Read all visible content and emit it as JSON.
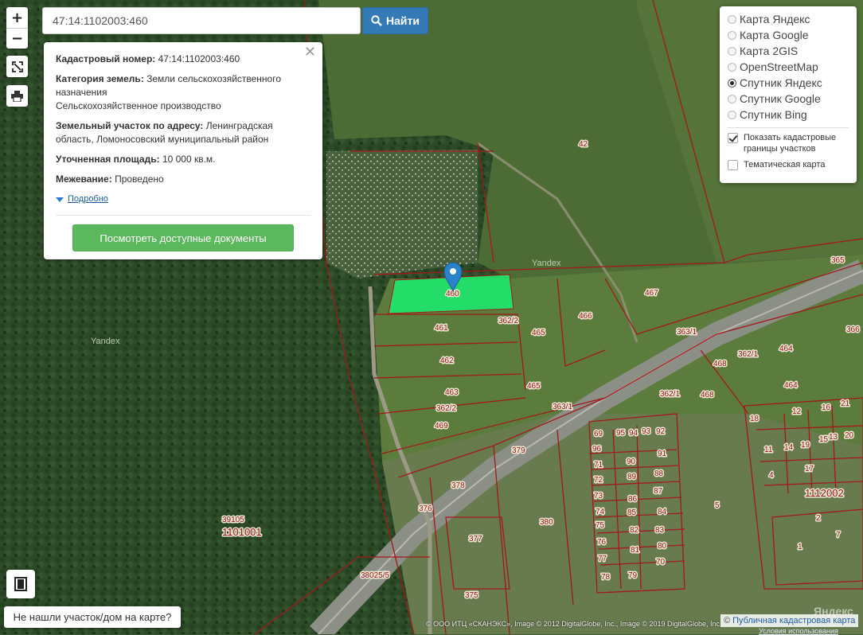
{
  "search": {
    "value": "47:14:1102003:460",
    "button_label": "Найти"
  },
  "zoom": {
    "in": "+",
    "out": "−"
  },
  "info_card": {
    "cadastral_label": "Кадастровый номер:",
    "cadastral_value": "47:14:1102003:460",
    "category_label": "Категория земель:",
    "category_value": "Земли сельскохозяйственного назначения",
    "usage_value": "Сельскохозяйственное производство",
    "address_label": "Земельный участок по адресу:",
    "address_value": "Ленинградская область, Ломоносовский муниципальный район",
    "area_label": "Уточненная площадь:",
    "area_value": "10 000 кв.м.",
    "survey_label": "Межевание:",
    "survey_value": "Проведено",
    "more_link": "Подробно",
    "docs_button": "Посмотреть доступные документы"
  },
  "layers": {
    "options": [
      {
        "label": "Карта Яндекс",
        "selected": false
      },
      {
        "label": "Карта Google",
        "selected": false
      },
      {
        "label": "Карта 2GIS",
        "selected": false
      },
      {
        "label": "OpenStreetMap",
        "selected": false
      },
      {
        "label": "Спутник Яндекс",
        "selected": true
      },
      {
        "label": "Спутник Google",
        "selected": false
      },
      {
        "label": "Спутник Bing",
        "selected": false
      }
    ],
    "show_boundaries": {
      "label": "Показать кадастровые границы участков",
      "checked": true
    },
    "thematic": {
      "label": "Тематическая карта",
      "checked": false
    }
  },
  "bottom": {
    "not_found_button": "Не нашли участок/дом на карте?",
    "attribution": "© ООО ИТЦ «СКАНЭКС», Image © 2012 DigitalGlobe, Inc., Image © 2019 DigitalGlobe, Inc.",
    "terms": "Условия использования",
    "pkk_prefix": "©",
    "pkk_link": "Публичная кадастровая карта",
    "yandex_logo": "Яндекс"
  },
  "map": {
    "watermarks": [
      "Yandex",
      "Yandex"
    ],
    "selected_parcel_label": "460",
    "parcel_labels": [
      "42",
      "365",
      "467",
      "466",
      "461",
      "362/2",
      "465",
      "363/1",
      "362/1",
      "464",
      "366",
      "468",
      "462",
      "463",
      "465",
      "362/1",
      "468",
      "464",
      "362/2",
      "363/1",
      "469",
      "379",
      "378",
      "376",
      "377",
      "380",
      "375",
      "38025/5",
      "39105",
      "69",
      "96",
      "71",
      "72",
      "73",
      "74",
      "75",
      "76",
      "77",
      "78",
      "79",
      "95",
      "94",
      "93",
      "92",
      "91",
      "90",
      "89",
      "88",
      "87",
      "86",
      "85",
      "84",
      "83",
      "82",
      "81",
      "80",
      "70",
      "5",
      "18",
      "12",
      "16",
      "21",
      "11",
      "14",
      "19",
      "15",
      "13",
      "20",
      "17",
      "4",
      "2",
      "7",
      "1"
    ],
    "block_labels": [
      "1101001",
      "1112002"
    ]
  },
  "colors": {
    "parcel_border": "#a3191a",
    "selected_parcel": "#22e36a",
    "marker": "#2b82cb",
    "search_button": "#337ab7",
    "docs_button": "#5cb85c"
  }
}
